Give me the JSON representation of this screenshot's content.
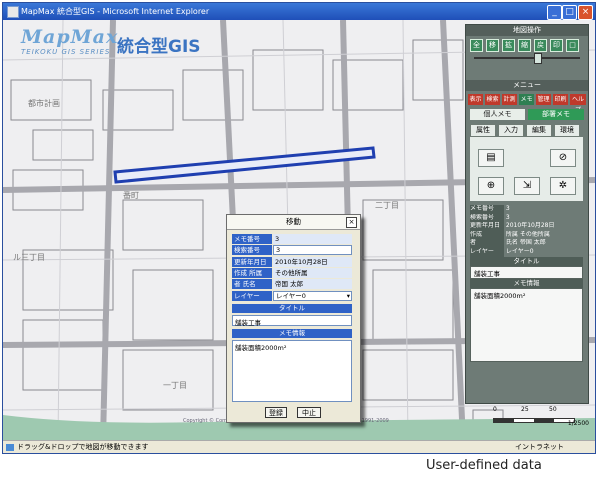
{
  "window": {
    "title": "MapMax 統合型GIS - Microsoft Internet Explorer",
    "controls": [
      "_",
      "□",
      "×"
    ]
  },
  "logo": {
    "brand": "MapMax",
    "series": "TEIKOKU GIS SERIES",
    "product": "統合型GIS"
  },
  "map": {
    "labels": [
      "都市計画",
      "番町",
      "二丁目",
      "一丁目",
      "ル三丁目"
    ],
    "copyright": "Copyright © Computer Aided Development Corporation Ltd. (Cadcorp) 1991-2009",
    "scale_ticks": [
      "0",
      "25",
      "50"
    ],
    "scale_ratio": "1/2500",
    "line_color": "#1f3fb0"
  },
  "panel": {
    "map_ops_title": "地図操作",
    "map_tools": [
      "全",
      "移",
      "拡",
      "縮",
      "戻",
      "印",
      "□"
    ],
    "menu_title": "メニュー",
    "menu_buttons": [
      "表示",
      "検索",
      "計測",
      "メモ",
      "管理",
      "印刷",
      "ヘルプ"
    ],
    "memo_tabs": [
      "個人メモ",
      "部署メモ"
    ],
    "memo_subtabs": [
      "属性",
      "入力",
      "編集",
      "環境"
    ],
    "info_rows": [
      {
        "key": "メモ番号",
        "value": "3"
      },
      {
        "key": "検索番号",
        "value": "3"
      },
      {
        "key": "更新年月日",
        "value": "2010年10月28日"
      },
      {
        "key": "作成",
        "value": "所属 その他所属"
      },
      {
        "key": "者",
        "value": "氏名 帝国 太郎"
      },
      {
        "key": "レイヤー",
        "value": "レイヤー0"
      }
    ],
    "title_header": "タイトル",
    "title_value": "舗装工事",
    "memo_header": "メモ情報",
    "memo_value": "舗装面積2000m²"
  },
  "dialog": {
    "title": "移動",
    "memo_no_label": "メモ番号",
    "memo_no": "3",
    "search_no_label": "検索番号",
    "search_no": "3",
    "updated_label": "更新年月日",
    "updated": "2010年10月28日",
    "creator_label": "作成 所属",
    "dept": "その他所属",
    "name_label": "者 氏名",
    "name": "帝国 太郎",
    "layer_label": "レイヤー",
    "layer_value": "レイヤー0",
    "title_header": "タイトル",
    "title_value": "舗装工事",
    "memo_header": "メモ情報",
    "memo_value": "舗装面積2000m²",
    "ok": "登録",
    "cancel": "中止"
  },
  "status": {
    "text": "ドラッグ&ドロップで地図が移動できます",
    "zone": "イントラネット"
  },
  "caption": "User-defined data"
}
